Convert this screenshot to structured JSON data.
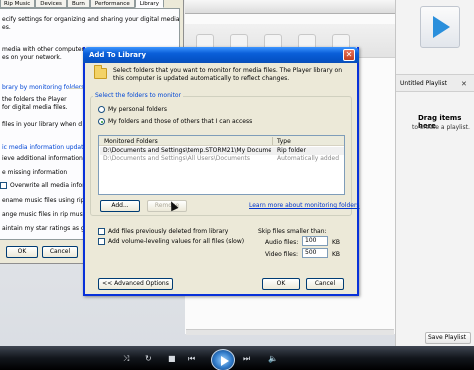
{
  "options_dialog": {
    "tabs": [
      "Rip Music",
      "Devices",
      "Burn",
      "Performance",
      "Library"
    ],
    "active_tab": "Library",
    "lines": [
      "ecify settings for organizing and sharing your digital media",
      "es."
    ],
    "sharing_text_1": "media with other computers",
    "sharing_text_2": "es on your network.",
    "section_monitor": "brary by monitoring folders",
    "monitor_text_1": "the folders the Player",
    "monitor_text_2": "for digital media files.",
    "monitor_text_3": "files in your library when d",
    "section_update": "ic media information updates fo",
    "update_options": [
      "ieve additional information from t",
      "e missing information",
      "Overwrite all media information",
      "ename music files using rip music se",
      "ange music files in rip music folder, u",
      "aintain my star ratings as global ra"
    ],
    "ok": "OK",
    "cancel": "Cancel"
  },
  "add_library": {
    "title": "Add To Library",
    "close_glyph": "✕",
    "description": "Select folders that you want to monitor for media files. The Player library on this computer is updated automatically to reflect changes.",
    "group_label": "Select the folders to monitor",
    "radio_personal": "My personal folders",
    "radio_mine_others": "My folders and those of others that I can access",
    "selected_radio": "mine_others",
    "columns": [
      "Monitored Folders",
      "Type"
    ],
    "rows": [
      {
        "folder": "D:\\Documents and Settings\\temp.STORM21\\My Documents...",
        "type": "Rip folder"
      },
      {
        "folder": "D:\\Documents and Settings\\All Users\\Documents",
        "type": "Automatically added"
      }
    ],
    "add_button": "Add...",
    "remove_button": "Remove",
    "learn_more_link": "Learn more about monitoring folders",
    "chk_deleted": "Add files previously deleted from library",
    "chk_volume": "Add volume-leveling values for all files (slow)",
    "skip_label": "Skip files smaller than:",
    "audio_label": "Audio files:",
    "audio_value": "100",
    "audio_unit": "KB",
    "video_label": "Video files:",
    "video_value": "500",
    "video_unit": "KB",
    "advanced_button": "<< Advanced Options",
    "ok_button": "OK",
    "cancel_button": "Cancel"
  },
  "wmp": {
    "playlist_title": "Untitled Playlist",
    "playlist_close": "✕",
    "drag_here": "Drag items here",
    "drag_sub": "to create a playlist.",
    "save_playlist": "Save Playlist"
  },
  "player_controls": {
    "shuffle": "⤨",
    "repeat": "↻",
    "stop": "■",
    "prev": "⏮",
    "next": "⏭",
    "mute": "🔈"
  }
}
